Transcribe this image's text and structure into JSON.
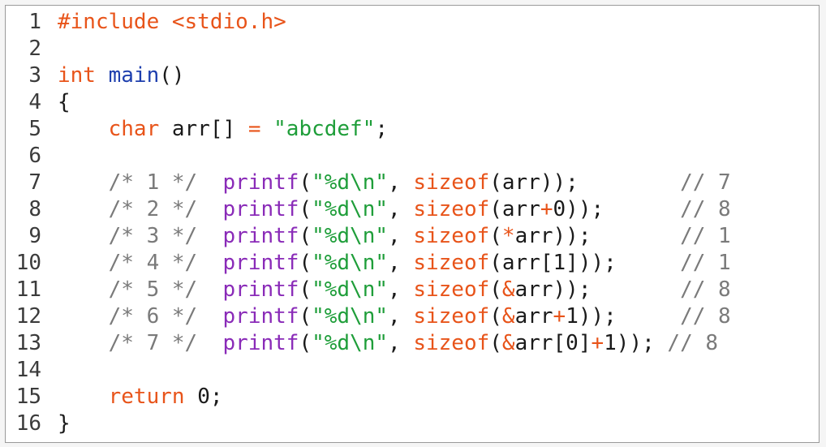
{
  "editor": {
    "lines": [
      {
        "num": "1",
        "tokens": [
          {
            "t": "#include <stdio.h>",
            "c": "pre"
          }
        ]
      },
      {
        "num": "2",
        "tokens": []
      },
      {
        "num": "3",
        "tokens": [
          {
            "t": "int",
            "c": "kw"
          },
          {
            "t": " ",
            "c": "pl"
          },
          {
            "t": "main",
            "c": "fn"
          },
          {
            "t": "()",
            "c": "pl"
          }
        ]
      },
      {
        "num": "4",
        "tokens": [
          {
            "t": "{",
            "c": "pl"
          }
        ]
      },
      {
        "num": "5",
        "tokens": [
          {
            "t": "    ",
            "c": "pl"
          },
          {
            "t": "char",
            "c": "kw"
          },
          {
            "t": " arr[] ",
            "c": "pl"
          },
          {
            "t": "=",
            "c": "op"
          },
          {
            "t": " ",
            "c": "pl"
          },
          {
            "t": "\"abcdef\"",
            "c": "str"
          },
          {
            "t": ";",
            "c": "pl"
          }
        ]
      },
      {
        "num": "6",
        "tokens": []
      },
      {
        "num": "7",
        "tokens": [
          {
            "t": "    ",
            "c": "pl"
          },
          {
            "t": "/* 1 */",
            "c": "cm"
          },
          {
            "t": "  ",
            "c": "pl"
          },
          {
            "t": "printf",
            "c": "cl"
          },
          {
            "t": "(",
            "c": "pl"
          },
          {
            "t": "\"%d\\n\"",
            "c": "str"
          },
          {
            "t": ", ",
            "c": "pl"
          },
          {
            "t": "sizeof",
            "c": "kw"
          },
          {
            "t": "(arr));",
            "c": "pl"
          },
          {
            "t": "        ",
            "c": "pl"
          },
          {
            "t": "// 7",
            "c": "cm"
          }
        ]
      },
      {
        "num": "8",
        "tokens": [
          {
            "t": "    ",
            "c": "pl"
          },
          {
            "t": "/* 2 */",
            "c": "cm"
          },
          {
            "t": "  ",
            "c": "pl"
          },
          {
            "t": "printf",
            "c": "cl"
          },
          {
            "t": "(",
            "c": "pl"
          },
          {
            "t": "\"%d\\n\"",
            "c": "str"
          },
          {
            "t": ", ",
            "c": "pl"
          },
          {
            "t": "sizeof",
            "c": "kw"
          },
          {
            "t": "(arr",
            "c": "pl"
          },
          {
            "t": "+",
            "c": "op"
          },
          {
            "t": "0));",
            "c": "pl"
          },
          {
            "t": "      ",
            "c": "pl"
          },
          {
            "t": "// 8",
            "c": "cm"
          }
        ]
      },
      {
        "num": "9",
        "tokens": [
          {
            "t": "    ",
            "c": "pl"
          },
          {
            "t": "/* 3 */",
            "c": "cm"
          },
          {
            "t": "  ",
            "c": "pl"
          },
          {
            "t": "printf",
            "c": "cl"
          },
          {
            "t": "(",
            "c": "pl"
          },
          {
            "t": "\"%d\\n\"",
            "c": "str"
          },
          {
            "t": ", ",
            "c": "pl"
          },
          {
            "t": "sizeof",
            "c": "kw"
          },
          {
            "t": "(",
            "c": "pl"
          },
          {
            "t": "*",
            "c": "op"
          },
          {
            "t": "arr));",
            "c": "pl"
          },
          {
            "t": "       ",
            "c": "pl"
          },
          {
            "t": "// 1",
            "c": "cm"
          }
        ]
      },
      {
        "num": "10",
        "tokens": [
          {
            "t": "    ",
            "c": "pl"
          },
          {
            "t": "/* 4 */",
            "c": "cm"
          },
          {
            "t": "  ",
            "c": "pl"
          },
          {
            "t": "printf",
            "c": "cl"
          },
          {
            "t": "(",
            "c": "pl"
          },
          {
            "t": "\"%d\\n\"",
            "c": "str"
          },
          {
            "t": ", ",
            "c": "pl"
          },
          {
            "t": "sizeof",
            "c": "kw"
          },
          {
            "t": "(arr[1]));",
            "c": "pl"
          },
          {
            "t": "     ",
            "c": "pl"
          },
          {
            "t": "// 1",
            "c": "cm"
          }
        ]
      },
      {
        "num": "11",
        "tokens": [
          {
            "t": "    ",
            "c": "pl"
          },
          {
            "t": "/* 5 */",
            "c": "cm"
          },
          {
            "t": "  ",
            "c": "pl"
          },
          {
            "t": "printf",
            "c": "cl"
          },
          {
            "t": "(",
            "c": "pl"
          },
          {
            "t": "\"%d\\n\"",
            "c": "str"
          },
          {
            "t": ", ",
            "c": "pl"
          },
          {
            "t": "sizeof",
            "c": "kw"
          },
          {
            "t": "(",
            "c": "pl"
          },
          {
            "t": "&",
            "c": "op"
          },
          {
            "t": "arr));",
            "c": "pl"
          },
          {
            "t": "       ",
            "c": "pl"
          },
          {
            "t": "// 8",
            "c": "cm"
          }
        ]
      },
      {
        "num": "12",
        "tokens": [
          {
            "t": "    ",
            "c": "pl"
          },
          {
            "t": "/* 6 */",
            "c": "cm"
          },
          {
            "t": "  ",
            "c": "pl"
          },
          {
            "t": "printf",
            "c": "cl"
          },
          {
            "t": "(",
            "c": "pl"
          },
          {
            "t": "\"%d\\n\"",
            "c": "str"
          },
          {
            "t": ", ",
            "c": "pl"
          },
          {
            "t": "sizeof",
            "c": "kw"
          },
          {
            "t": "(",
            "c": "pl"
          },
          {
            "t": "&",
            "c": "op"
          },
          {
            "t": "arr",
            "c": "pl"
          },
          {
            "t": "+",
            "c": "op"
          },
          {
            "t": "1));",
            "c": "pl"
          },
          {
            "t": "     ",
            "c": "pl"
          },
          {
            "t": "// 8",
            "c": "cm"
          }
        ]
      },
      {
        "num": "13",
        "tokens": [
          {
            "t": "    ",
            "c": "pl"
          },
          {
            "t": "/* 7 */",
            "c": "cm"
          },
          {
            "t": "  ",
            "c": "pl"
          },
          {
            "t": "printf",
            "c": "cl"
          },
          {
            "t": "(",
            "c": "pl"
          },
          {
            "t": "\"%d\\n\"",
            "c": "str"
          },
          {
            "t": ", ",
            "c": "pl"
          },
          {
            "t": "sizeof",
            "c": "kw"
          },
          {
            "t": "(",
            "c": "pl"
          },
          {
            "t": "&",
            "c": "op"
          },
          {
            "t": "arr[0]",
            "c": "pl"
          },
          {
            "t": "+",
            "c": "op"
          },
          {
            "t": "1));",
            "c": "pl"
          },
          {
            "t": " ",
            "c": "pl"
          },
          {
            "t": "// 8",
            "c": "cm"
          }
        ]
      },
      {
        "num": "14",
        "tokens": []
      },
      {
        "num": "15",
        "tokens": [
          {
            "t": "    ",
            "c": "pl"
          },
          {
            "t": "return",
            "c": "kw"
          },
          {
            "t": " 0;",
            "c": "pl"
          }
        ]
      },
      {
        "num": "16",
        "tokens": [
          {
            "t": "}",
            "c": "pl"
          }
        ]
      }
    ]
  },
  "colors": {
    "keyword": "#e8541a",
    "function": "#1e3fae",
    "string": "#1f9e3a",
    "comment": "#7a7a7a",
    "library_call": "#8a2bb8",
    "text": "#1a1a1a"
  }
}
